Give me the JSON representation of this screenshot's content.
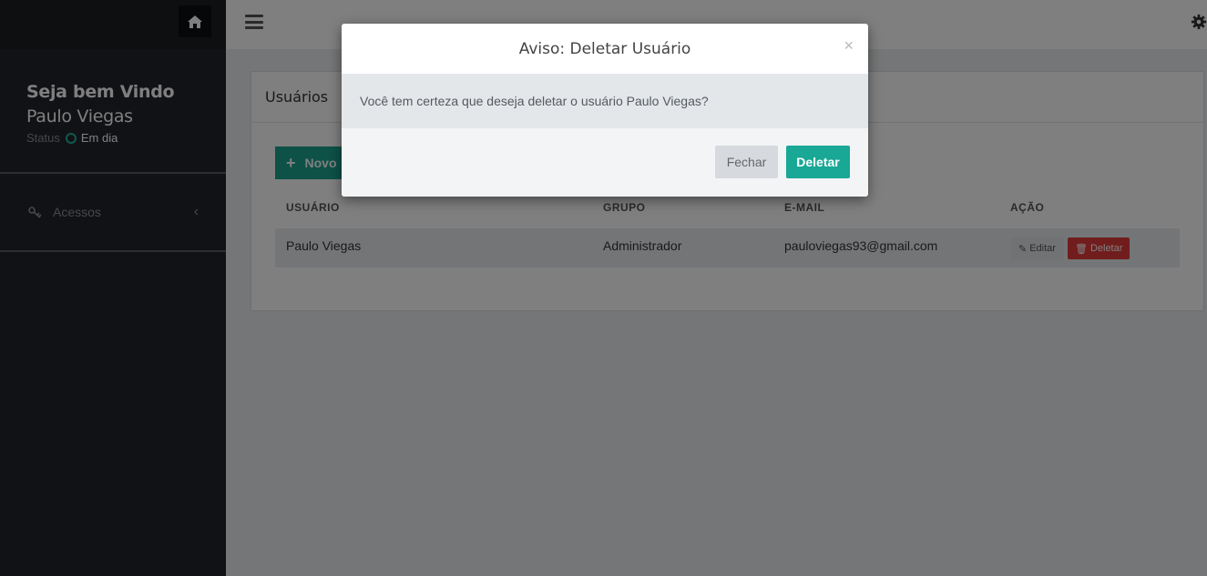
{
  "sidebar": {
    "welcome_title": "Seja bem Vindo",
    "user_name": "Paulo Viegas",
    "status_label": "Status",
    "status_value": "Em dia",
    "status_color": "#20b2a0",
    "items": [
      {
        "label": "Acessos",
        "icon": "key-icon",
        "chevron": "‹"
      }
    ]
  },
  "panel": {
    "title": "Usuários",
    "new_button_label": "Novo",
    "table": {
      "headers": [
        "USUÁRIO",
        "GRUPO",
        "E-MAIL",
        "AÇÃO"
      ],
      "rows": [
        {
          "user": "Paulo Viegas",
          "group": "Administrador",
          "email": "pauloviegas93@gmail.com",
          "edit_label": "Editar",
          "delete_label": "Deletar"
        }
      ]
    }
  },
  "modal": {
    "title": "Aviso: Deletar Usuário",
    "close_symbol": "×",
    "message": "Você tem certeza que deseja deletar o usuário Paulo Viegas?",
    "cancel_label": "Fechar",
    "confirm_label": "Deletar"
  },
  "colors": {
    "accent": "#18a895",
    "danger": "#e33a3a",
    "sidebar_bg": "#22252b"
  }
}
